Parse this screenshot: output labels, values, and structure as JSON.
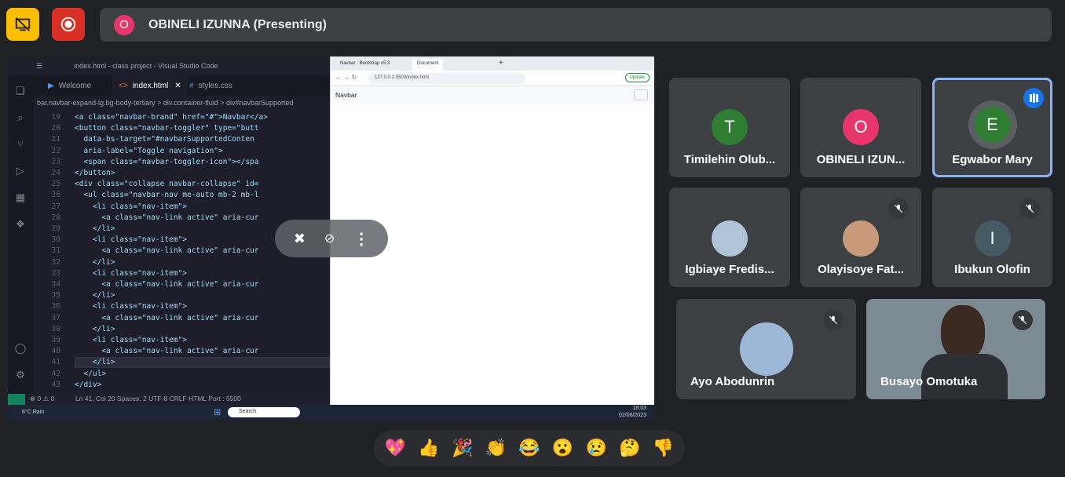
{
  "presenter_bar": {
    "avatar_letter": "O",
    "title": "OBINELI IZUNNA (Presenting)"
  },
  "vscode": {
    "window_title": "index.html - class project - Visual Studio Code",
    "tabs": [
      "Welcome",
      "index.html",
      "styles.css"
    ],
    "breadcrumb": "bar.navbar-expand-lg.bg-body-tertiary  > div.container-fluid  > div#navbarSupported",
    "line_numbers": [
      "19",
      "20",
      "21",
      "22",
      "23",
      "24",
      "25",
      "26",
      "27",
      "28",
      "29",
      "30",
      "31",
      "32",
      "33",
      "34",
      "35",
      "36",
      "37",
      "38",
      "39",
      "40",
      "41",
      "42",
      "43"
    ],
    "code_lines": [
      "<a class=\"navbar-brand\" href=\"#\">Navbar</a>",
      "<button class=\"navbar-toggler\" type=\"butt",
      "  data-bs-target=\"#navbarSupportedConten",
      "  aria-label=\"Toggle navigation\">",
      "  <span class=\"navbar-toggler-icon\"></spa",
      "</button>",
      "<div class=\"collapse navbar-collapse\" id=",
      "  <ul class=\"navbar-nav me-auto mb-2 mb-l",
      "    <li class=\"nav-item\">",
      "      <a class=\"nav-link active\" aria-cur",
      "    </li>",
      "    <li class=\"nav-item\">",
      "      <a class=\"nav-link active\" aria-cur",
      "    </li>",
      "    <li class=\"nav-item\">",
      "      <a class=\"nav-link active\" aria-cur",
      "    </li>",
      "    <li class=\"nav-item\">",
      "      <a class=\"nav-link active\" aria-cur",
      "    </li>",
      "    <li class=\"nav-item\">",
      "      <a class=\"nav-link active\" aria-cur",
      "    </li>",
      "  </ul>",
      "</div>"
    ],
    "status": "Ln 41, Col 20   Spaces: 2   UTF-8   CRLF   HTML   Port : 5500"
  },
  "browser": {
    "tabs": [
      "Navbar · Bootstrap v5.3",
      "Document"
    ],
    "url": "127.0.0.1:5500/index.html",
    "update_label": "Update",
    "navbar_brand": "Navbar"
  },
  "taskbar": {
    "weather": "6°C Rain",
    "search": "Search",
    "time": "18:03",
    "date": "02/06/2023"
  },
  "participants": [
    {
      "name": "Timilehin Olub...",
      "letter": "T",
      "color": "#2e7d32"
    },
    {
      "name": "OBINELI IZUN...",
      "letter": "O",
      "color": "#e8356c"
    },
    {
      "name": "Egwabor Mary",
      "letter": "E",
      "color": "#2e7d32"
    },
    {
      "name": "Igbiaye Fredis...",
      "letter": ""
    },
    {
      "name": "Olayisoye Fat...",
      "letter": ""
    },
    {
      "name": "Ibukun Olofin",
      "letter": "I",
      "color": "#455a64"
    },
    {
      "name": "Ayo Abodunrin",
      "letter": ""
    },
    {
      "name": "Busayo Omotuka",
      "letter": ""
    }
  ],
  "reactions": [
    "💖",
    "👍",
    "🎉",
    "👏",
    "😂",
    "😮",
    "😢",
    "🤔",
    "👎"
  ],
  "colors": {
    "speaking_border": "#8ab4f8",
    "present_btn": "#fbbc04",
    "record_btn": "#d93025"
  }
}
